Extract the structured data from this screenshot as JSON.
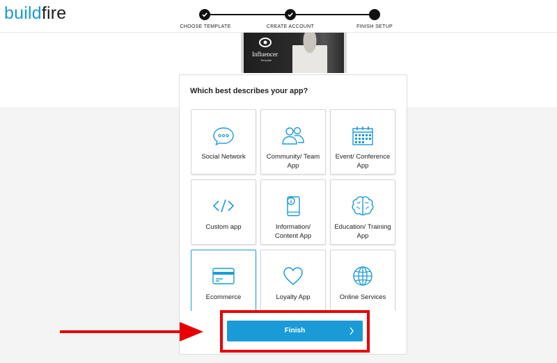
{
  "brand": {
    "logo_part1": "build",
    "logo_part2": "fire",
    "accent": "#1a9bd7"
  },
  "stepper": {
    "steps": [
      {
        "label": "CHOOSE TEMPLATE",
        "state": "done"
      },
      {
        "label": "CREATE ACCOUNT",
        "state": "done"
      },
      {
        "label": "FINISH SETUP",
        "state": "current"
      }
    ]
  },
  "template_preview": {
    "name": "Influencer",
    "sub": "Template"
  },
  "question": "Which best describes your app?",
  "categories": [
    {
      "label": "Social Network",
      "icon": "chat-bubble-icon"
    },
    {
      "label": "Community/ Team App",
      "icon": "people-icon"
    },
    {
      "label": "Event/ Conference App",
      "icon": "calendar-icon"
    },
    {
      "label": "Custom app",
      "icon": "code-icon"
    },
    {
      "label": "Information/ Content App",
      "icon": "phone-info-icon"
    },
    {
      "label": "Education/ Training App",
      "icon": "brain-icon"
    },
    {
      "label": "Ecommerce",
      "icon": "credit-card-icon",
      "selected": true
    },
    {
      "label": "Loyalty App",
      "icon": "heart-icon"
    },
    {
      "label": "Online Services",
      "icon": "globe-icon"
    }
  ],
  "finish_button": {
    "label": "Finish"
  },
  "annotation": {
    "arrow_color": "#e80000",
    "box_color": "#e80000"
  }
}
